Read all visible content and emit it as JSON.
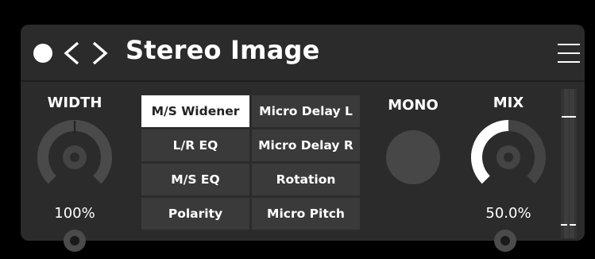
{
  "header": {
    "title": "Stereo Image",
    "power_icon": "circle-power-icon",
    "prev_icon": "chevron-left-icon",
    "next_icon": "chevron-right-icon",
    "menu_icon": "hamburger-menu-icon"
  },
  "width": {
    "label": "WIDTH",
    "value_text": "100%",
    "value_fraction": 1.0
  },
  "modes": {
    "selected": "M/S Widener",
    "items": [
      "M/S Widener",
      "Micro Delay L",
      "L/R EQ",
      "Micro Delay R",
      "M/S EQ",
      "Rotation",
      "Polarity",
      "Micro Pitch"
    ]
  },
  "mono": {
    "label": "MONO",
    "enabled": false
  },
  "mix": {
    "label": "MIX",
    "value_text": "50.0%",
    "value_fraction": 0.5
  },
  "colors": {
    "background": "#000000",
    "panel": "#2b2b2b",
    "button": "#3a3a3a",
    "active_button": "#ffffff",
    "knob_track": "#444444",
    "knob_fill": "#ffffff"
  }
}
